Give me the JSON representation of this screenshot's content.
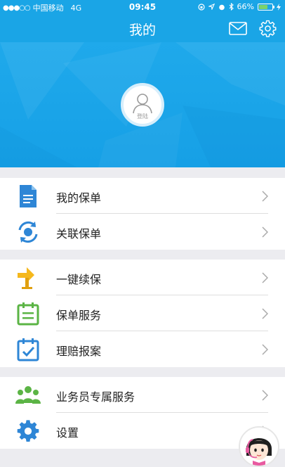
{
  "status_bar": {
    "signal_dots": "●●●○○",
    "carrier": "中国移动",
    "network": "4G",
    "time": "09:45",
    "battery": "66%",
    "battery_level": 0.66
  },
  "header": {
    "title": "我的"
  },
  "profile": {
    "login_label": "登陆"
  },
  "menu_groups": [
    [
      {
        "label": "我的保单",
        "icon": "document-icon"
      },
      {
        "label": "关联保单",
        "icon": "sync-icon"
      }
    ],
    [
      {
        "label": "一键续保",
        "icon": "arrow-sign-icon"
      },
      {
        "label": "保单服务",
        "icon": "calendar-list-icon"
      },
      {
        "label": "理赔报案",
        "icon": "calendar-check-icon"
      }
    ],
    [
      {
        "label": "业务员专属服务",
        "icon": "people-icon"
      },
      {
        "label": "设置",
        "icon": "gear-icon"
      }
    ]
  ],
  "colors": {
    "primary": "#1aa5e6",
    "icon_blue": "#2e86d6",
    "icon_yellow": "#f5b81c",
    "icon_green": "#5bb445"
  }
}
